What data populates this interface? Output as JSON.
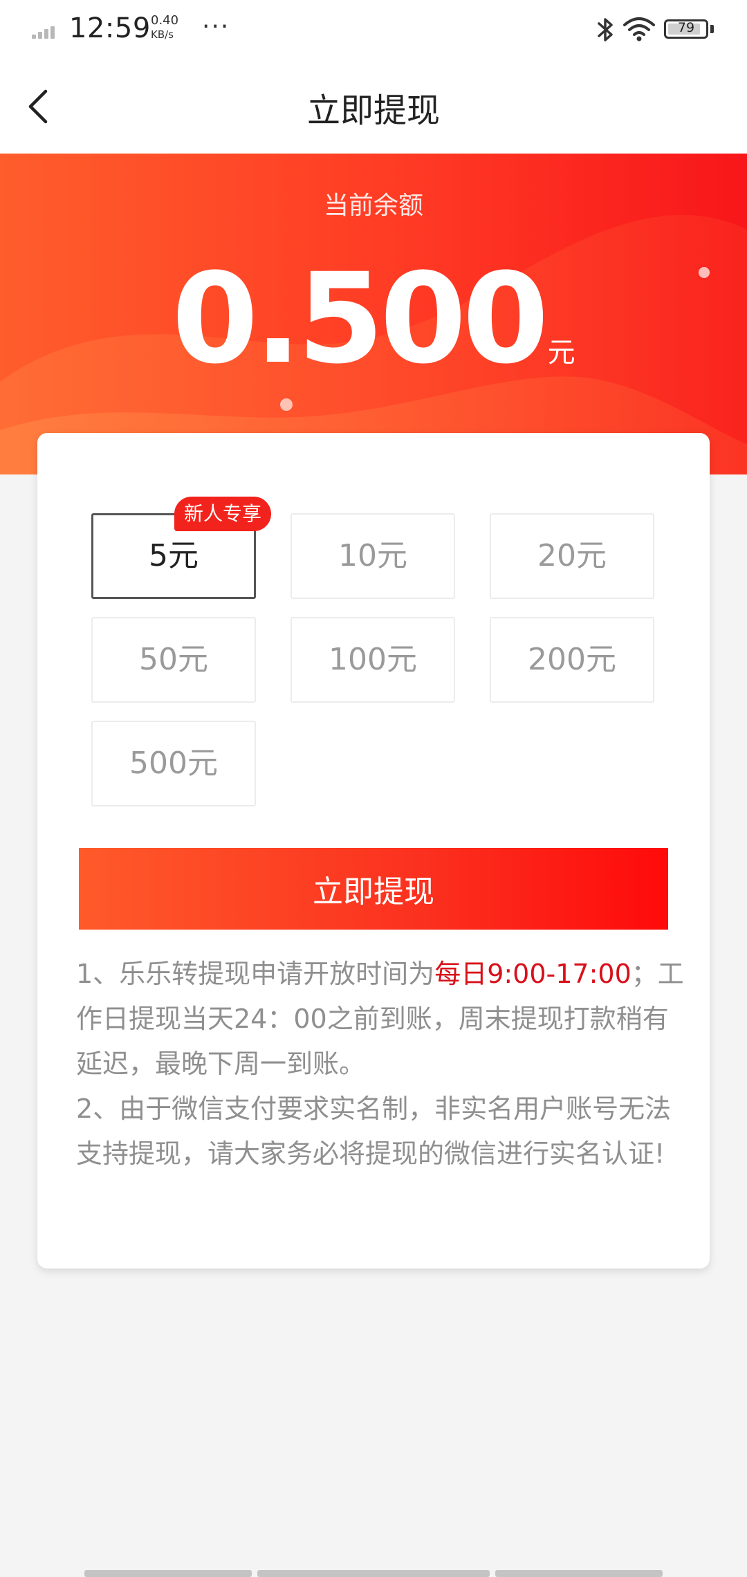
{
  "status_bar": {
    "time": "12:59",
    "speed_value": "0.40",
    "speed_unit": "KB/s",
    "more": "···",
    "battery": "79"
  },
  "header": {
    "title": "立即提现"
  },
  "balance": {
    "label": "当前余额",
    "amount": "0.500",
    "unit": "元"
  },
  "amount_options": [
    {
      "label": "5元",
      "selected": true,
      "badge": "新人专享"
    },
    {
      "label": "10元"
    },
    {
      "label": "20元"
    },
    {
      "label": "50元"
    },
    {
      "label": "100元"
    },
    {
      "label": "200元"
    },
    {
      "label": "500元"
    }
  ],
  "withdraw_button": "立即提现",
  "notes": {
    "line1_prefix": "1、乐乐转提现申请开放时间为",
    "line1_highlight": "每日9:00-17:00",
    "line1_suffix": "；工作日提现当天24：00之前到账，周末提现打款稍有延迟，最晚下周一到账。",
    "line2": "2、由于微信支付要求实名制，非实名用户账号无法支持提现，请大家务必将提现的微信进行实名认证!"
  },
  "colors": {
    "accent_red": "#f8161a",
    "accent_orange": "#ff5d2c",
    "highlight_text": "#d8101a"
  }
}
